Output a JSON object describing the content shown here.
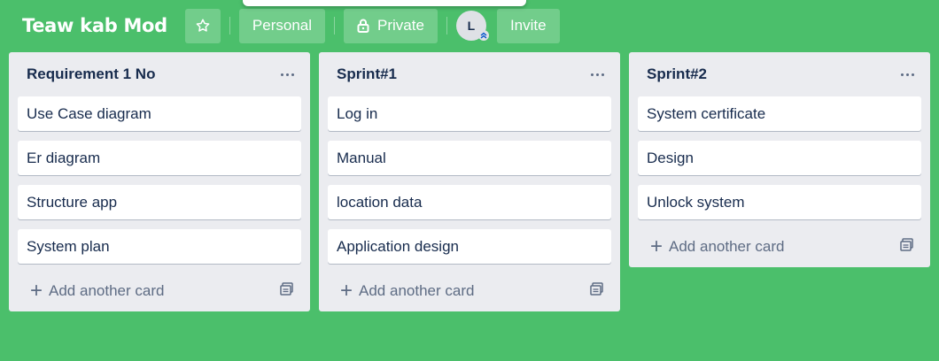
{
  "board": {
    "title": "Teaw kab Mod",
    "visibility_personal": "Personal",
    "visibility_private": "Private",
    "invite_label": "Invite",
    "member_initial": "L"
  },
  "colors": {
    "background": "#4bbf6b",
    "list_bg": "#ebecf0",
    "card_bg": "#ffffff",
    "text": "#172b4d",
    "muted": "#5e6c84"
  },
  "lists": [
    {
      "title": "Requirement 1 No",
      "cards": [
        "Use Case diagram",
        "Er diagram",
        "Structure app",
        "System plan"
      ],
      "add_label": "Add another card"
    },
    {
      "title": "Sprint#1",
      "cards": [
        "Log in",
        "Manual",
        "location data",
        "Application design"
      ],
      "add_label": "Add another card"
    },
    {
      "title": "Sprint#2",
      "cards": [
        "System certificate",
        "Design",
        "Unlock system"
      ],
      "add_label": "Add another card"
    }
  ],
  "icons": {
    "star": "star-icon",
    "lock": "lock-icon",
    "list_menu": "ellipsis-icon",
    "add": "plus-icon",
    "template": "card-template-icon",
    "member_badge": "chevron-up-double-icon"
  }
}
